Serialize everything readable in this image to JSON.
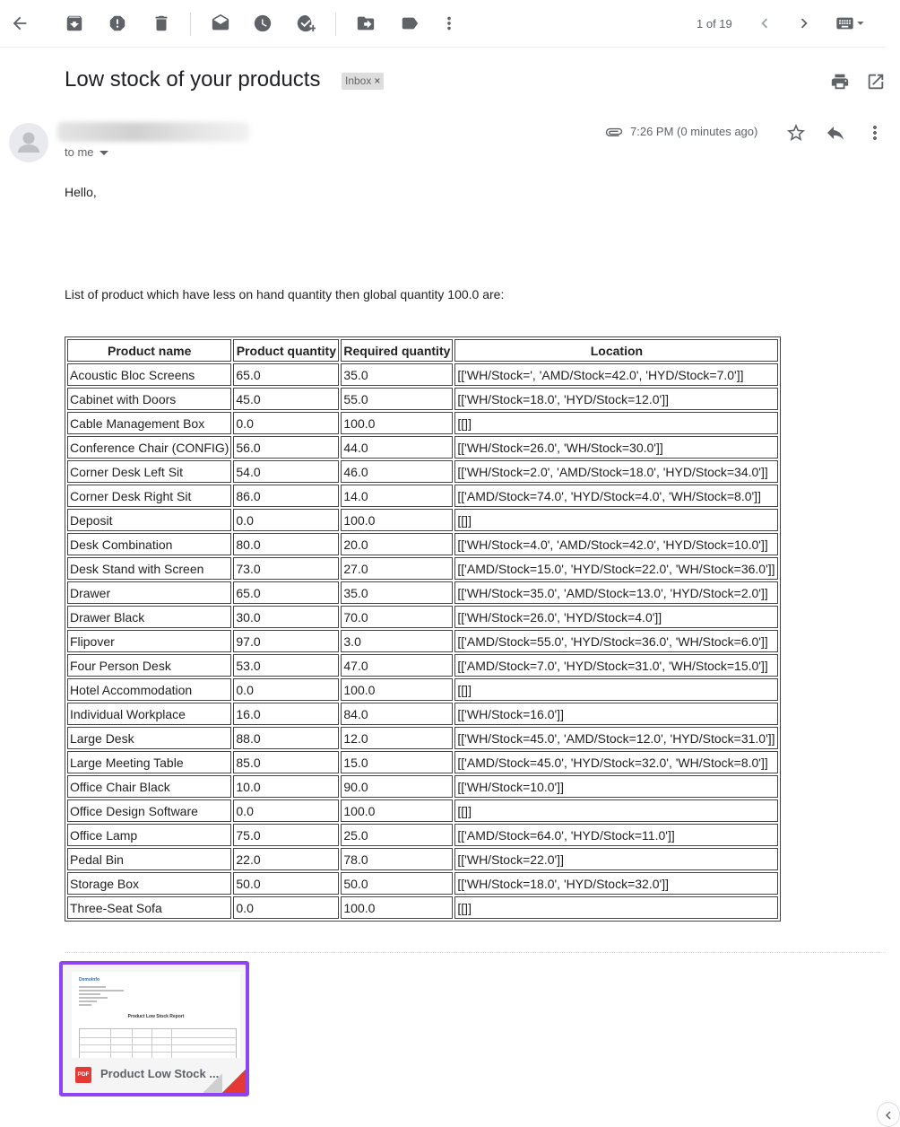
{
  "toolbar": {
    "icons": [
      "back-arrow-icon",
      "archive-icon",
      "report-spam-icon",
      "delete-icon",
      "mark-unread-icon",
      "snooze-icon",
      "add-to-tasks-icon",
      "move-to-icon",
      "labels-icon",
      "more-vert-icon",
      "newer-icon",
      "older-icon",
      "keyboard-icon"
    ],
    "pagination": "1 of 19"
  },
  "email": {
    "subject": "Low stock of your products",
    "label_chip": "Inbox",
    "label_close": "×",
    "to": "to me",
    "time": "7:26 PM (0 minutes ago)",
    "greeting": "Hello,",
    "intro": "List of product which have less on hand quantity then global quantity 100.0 are:"
  },
  "table": {
    "headers": [
      "Product name",
      "Product quantity",
      "Required quantity",
      "Location"
    ],
    "rows": [
      [
        "Acoustic Bloc Screens",
        "65.0",
        "35.0",
        "[['WH/Stock=', 'AMD/Stock=42.0', 'HYD/Stock=7.0']]"
      ],
      [
        "Cabinet with Doors",
        "45.0",
        "55.0",
        "[['WH/Stock=18.0', 'HYD/Stock=12.0']]"
      ],
      [
        "Cable Management Box",
        "0.0",
        "100.0",
        "[[]]"
      ],
      [
        "Conference Chair (CONFIG)",
        "56.0",
        "44.0",
        "[['WH/Stock=26.0', 'WH/Stock=30.0']]"
      ],
      [
        "Corner Desk Left Sit",
        "54.0",
        "46.0",
        "[['WH/Stock=2.0', 'AMD/Stock=18.0', 'HYD/Stock=34.0']]"
      ],
      [
        "Corner Desk Right Sit",
        "86.0",
        "14.0",
        "[['AMD/Stock=74.0', 'HYD/Stock=4.0', 'WH/Stock=8.0']]"
      ],
      [
        "Deposit",
        "0.0",
        "100.0",
        "[[]]"
      ],
      [
        "Desk Combination",
        "80.0",
        "20.0",
        "[['WH/Stock=4.0', 'AMD/Stock=42.0', 'HYD/Stock=10.0']]"
      ],
      [
        "Desk Stand with Screen",
        "73.0",
        "27.0",
        "[['AMD/Stock=15.0', 'HYD/Stock=22.0', 'WH/Stock=36.0']]"
      ],
      [
        "Drawer",
        "65.0",
        "35.0",
        "[['WH/Stock=35.0', 'AMD/Stock=13.0', 'HYD/Stock=2.0']]"
      ],
      [
        "Drawer Black",
        "30.0",
        "70.0",
        "[['WH/Stock=26.0', 'HYD/Stock=4.0']]"
      ],
      [
        "Flipover",
        "97.0",
        "3.0",
        "[['AMD/Stock=55.0', 'HYD/Stock=36.0', 'WH/Stock=6.0']]"
      ],
      [
        "Four Person Desk",
        "53.0",
        "47.0",
        "[['AMD/Stock=7.0', 'HYD/Stock=31.0', 'WH/Stock=15.0']]"
      ],
      [
        "Hotel Accommodation",
        "0.0",
        "100.0",
        "[[]]"
      ],
      [
        "Individual Workplace",
        "16.0",
        "84.0",
        "[['WH/Stock=16.0']]"
      ],
      [
        "Large Desk",
        "88.0",
        "12.0",
        "[['WH/Stock=45.0', 'AMD/Stock=12.0', 'HYD/Stock=31.0']]"
      ],
      [
        "Large Meeting Table",
        "85.0",
        "15.0",
        "[['AMD/Stock=45.0', 'HYD/Stock=32.0', 'WH/Stock=8.0']]"
      ],
      [
        "Office Chair Black",
        "10.0",
        "90.0",
        "[['WH/Stock=10.0']]"
      ],
      [
        "Office Design Software",
        "0.0",
        "100.0",
        "[[]]"
      ],
      [
        "Office Lamp",
        "75.0",
        "25.0",
        "[['AMD/Stock=64.0', 'HYD/Stock=11.0']]"
      ],
      [
        "Pedal Bin",
        "22.0",
        "78.0",
        "[['WH/Stock=22.0']]"
      ],
      [
        "Storage Box",
        "50.0",
        "50.0",
        "[['WH/Stock=18.0', 'HYD/Stock=32.0']]"
      ],
      [
        "Three-Seat Sofa",
        "0.0",
        "100.0",
        "[[]]"
      ]
    ]
  },
  "attachment": {
    "type_badge": "PDF",
    "name": "Product Low Stock ...",
    "preview_brand": "DemoInfo",
    "preview_title": "Product Low Stock Report",
    "accent_color": "#8e44f0"
  }
}
